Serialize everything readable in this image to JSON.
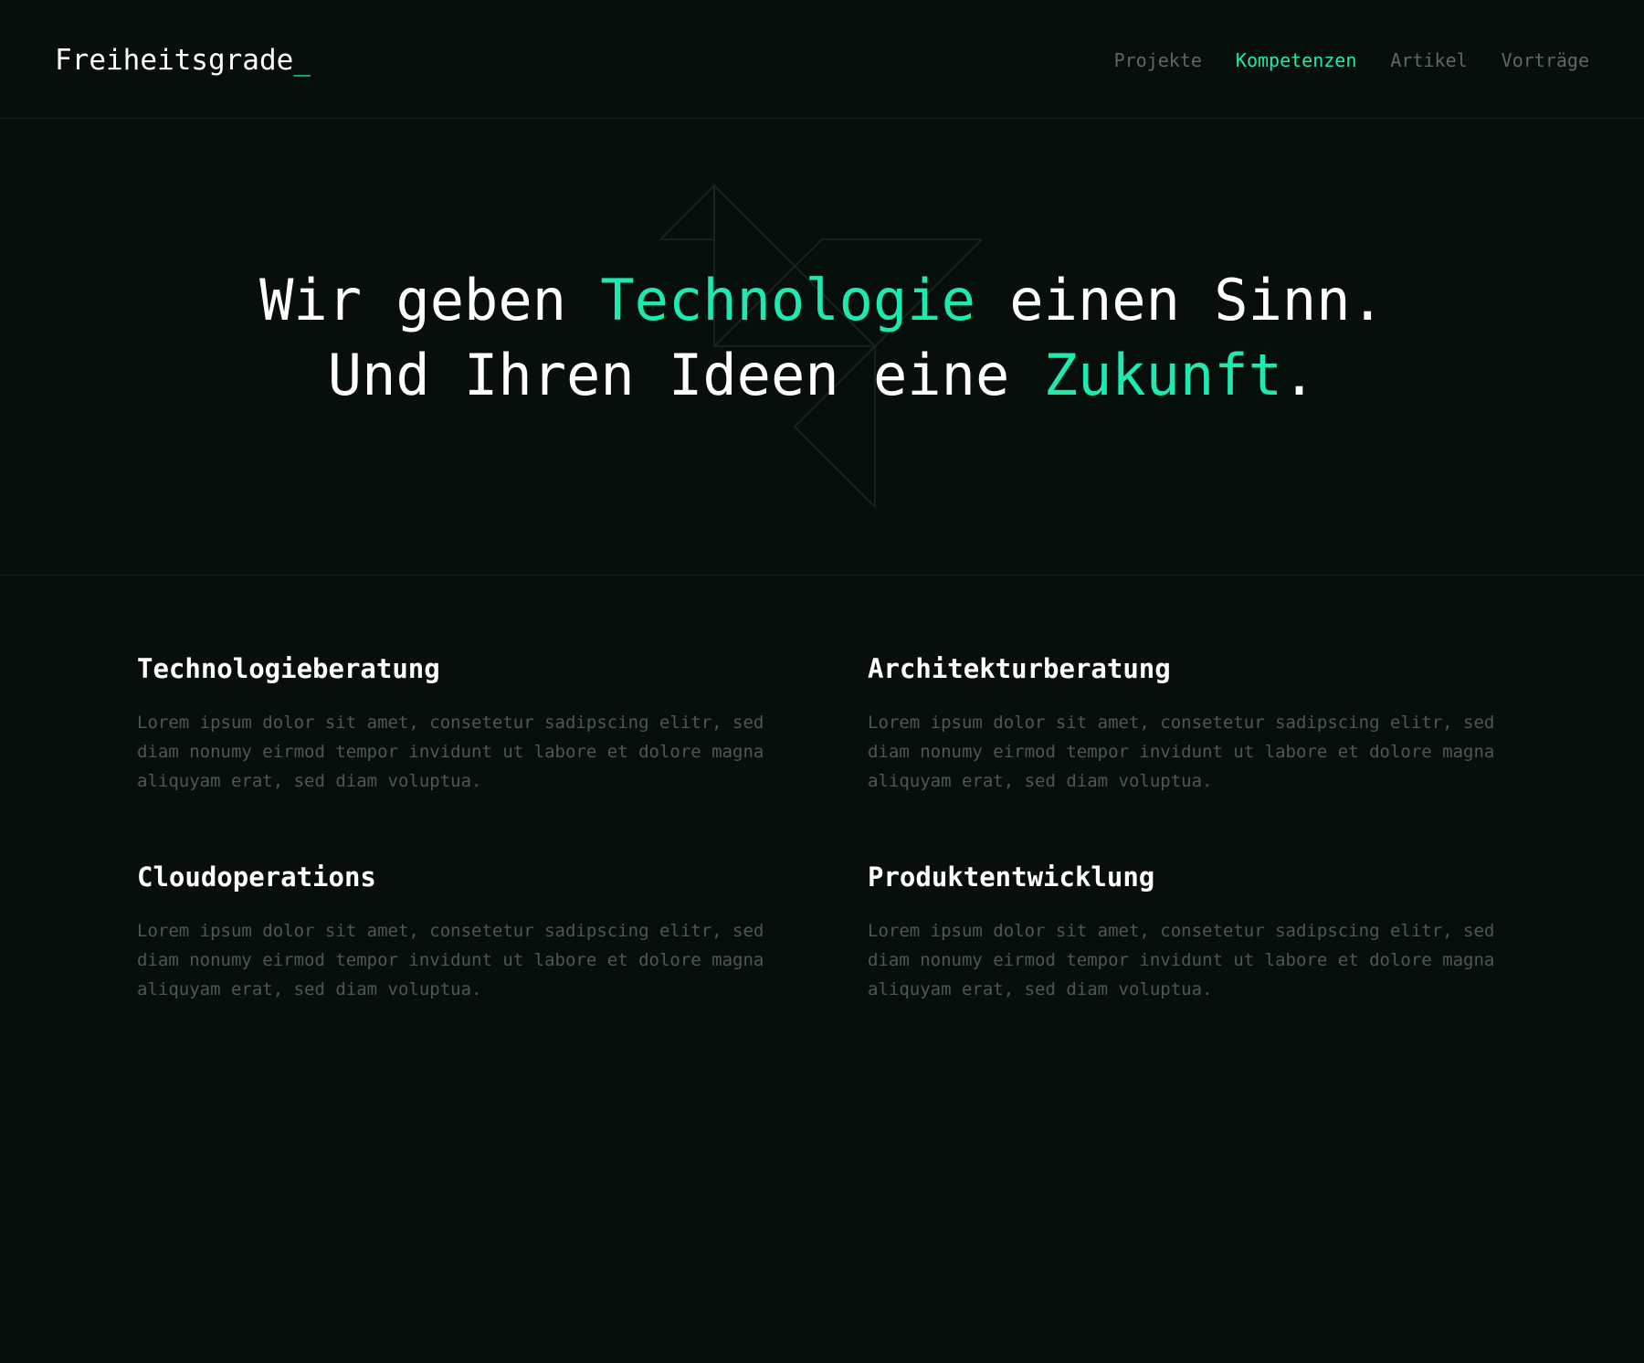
{
  "header": {
    "logo_text": "Freiheitsgrade",
    "logo_cursor": "_",
    "nav": [
      {
        "label": "Projekte",
        "active": false
      },
      {
        "label": "Kompetenzen",
        "active": true
      },
      {
        "label": "Artikel",
        "active": false
      },
      {
        "label": "Vorträge",
        "active": false
      }
    ]
  },
  "hero": {
    "line1_part1": "Wir geben ",
    "line1_accent": "Technologie",
    "line1_part2": " einen Sinn.",
    "line2_part1": "Und Ihren Ideen eine ",
    "line2_accent": "Zukunft",
    "line2_part2": "."
  },
  "services": [
    {
      "title": "Technologieberatung",
      "text": "Lorem ipsum dolor sit amet, consetetur sadipscing elitr, sed diam nonumy eirmod tempor invidunt ut labore et dolore magna aliquyam erat, sed diam voluptua."
    },
    {
      "title": "Architekturberatung",
      "text": "Lorem ipsum dolor sit amet, consetetur sadipscing elitr, sed diam nonumy eirmod tempor invidunt ut labore et dolore magna aliquyam erat, sed diam voluptua."
    },
    {
      "title": "Cloudoperations",
      "text": "Lorem ipsum dolor sit amet, consetetur sadipscing elitr, sed diam nonumy eirmod tempor invidunt ut labore et dolore magna aliquyam erat, sed diam voluptua."
    },
    {
      "title": "Produktentwicklung",
      "text": "Lorem ipsum dolor sit amet, consetetur sadipscing elitr, sed diam nonumy eirmod tempor invidunt ut labore et dolore magna aliquyam erat, sed diam voluptua."
    }
  ],
  "colors": {
    "background": "#070f0d",
    "accent": "#1de9b0",
    "text": "#ffffff",
    "muted": "#4f5754"
  }
}
